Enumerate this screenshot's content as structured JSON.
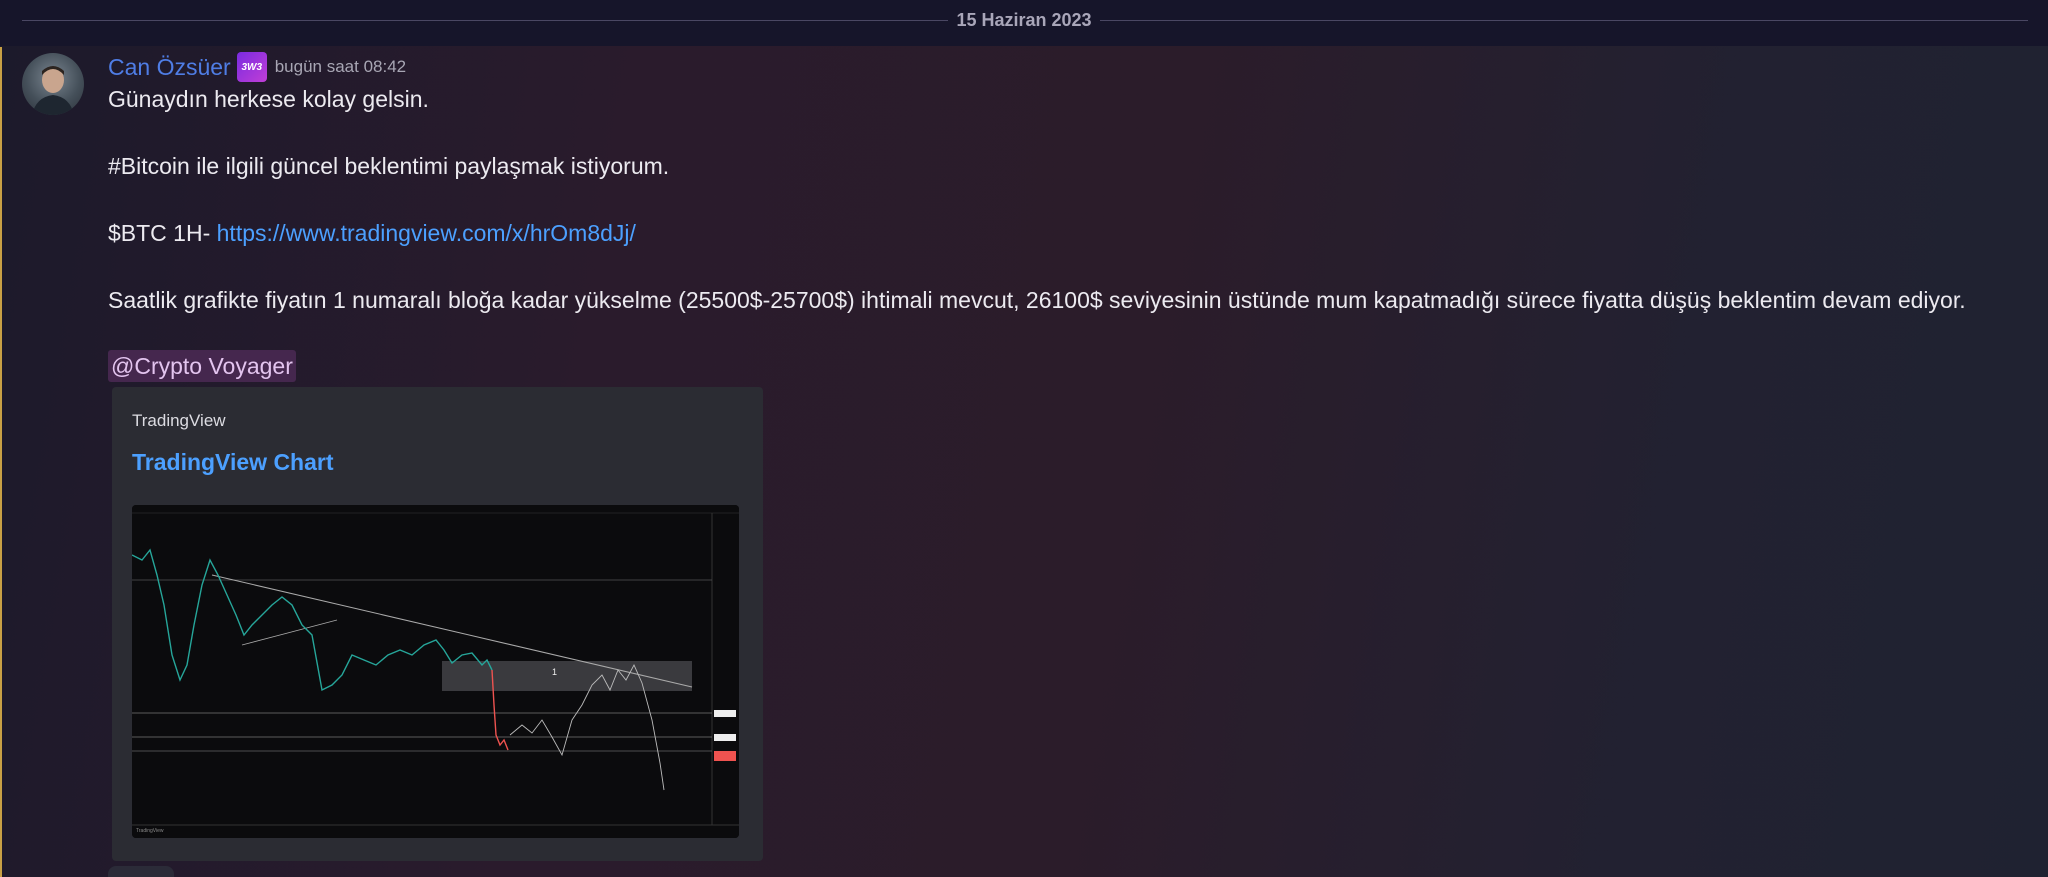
{
  "date_divider": "15 Haziran 2023",
  "message": {
    "author": "Can Özsüer",
    "badge_text": "3W3",
    "timestamp": "bugün saat 08:42",
    "line1": "Günaydın herkese kolay gelsin.",
    "line2": "#Bitcoin ile ilgili güncel beklentimi paylaşmak istiyorum.",
    "line3_prefix": "$BTC 1H- ",
    "line3_link": "https://www.tradingview.com/x/hrOm8dJj/",
    "line4": "Saatlik grafikte fiyatın 1 numaralı bloğa kadar yükselme (25500$-25700$) ihtimali mevcut, 26100$ seviyesinin üstünde mum kapatmadığı sürece fiyatta düşüş beklentim devam ediyor.",
    "mention": "@Crypto Voyager"
  },
  "embed": {
    "provider": "TradingView",
    "title": "TradingView Chart",
    "image_alt": "BTC/USDT 1H chart with descending trendline and projection"
  },
  "colors": {
    "username": "#4f7de5",
    "link": "#4ca0ff",
    "mention_bg": "#45274e",
    "accent": "#c8a045"
  }
}
